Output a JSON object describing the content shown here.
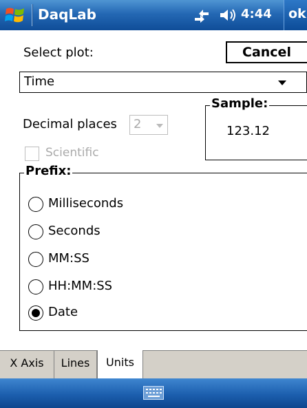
{
  "titlebar": {
    "app_title": "DaqLab",
    "time": "4:44",
    "ok_label": "ok"
  },
  "form": {
    "select_plot_label": "Select plot:",
    "cancel_label": "Cancel",
    "plot_selected": "Time",
    "decimal_places_label": "Decimal places",
    "decimal_places_value": "2",
    "scientific_label": "Scientific",
    "scientific_checked": false,
    "sample_title": "Sample:",
    "sample_value": "123.12",
    "prefix_title": "Prefix:",
    "prefix_options": [
      {
        "label": "Milliseconds",
        "selected": false
      },
      {
        "label": "Seconds",
        "selected": false
      },
      {
        "label": "MM:SS",
        "selected": false
      },
      {
        "label": "HH:MM:SS",
        "selected": false
      },
      {
        "label": "Date",
        "selected": true
      }
    ]
  },
  "tabs": [
    {
      "label": "X Axis",
      "active": false
    },
    {
      "label": "Lines",
      "active": false
    },
    {
      "label": "Units",
      "active": true
    }
  ],
  "icons": {
    "start": "windows-flag-icon",
    "connectivity": "connectivity-icon",
    "volume": "speaker-icon",
    "keyboard": "keyboard-icon"
  },
  "colors": {
    "titlebar": "#2468b4",
    "bottombar": "#1c5fae",
    "disabled": "#aaaaaa"
  }
}
